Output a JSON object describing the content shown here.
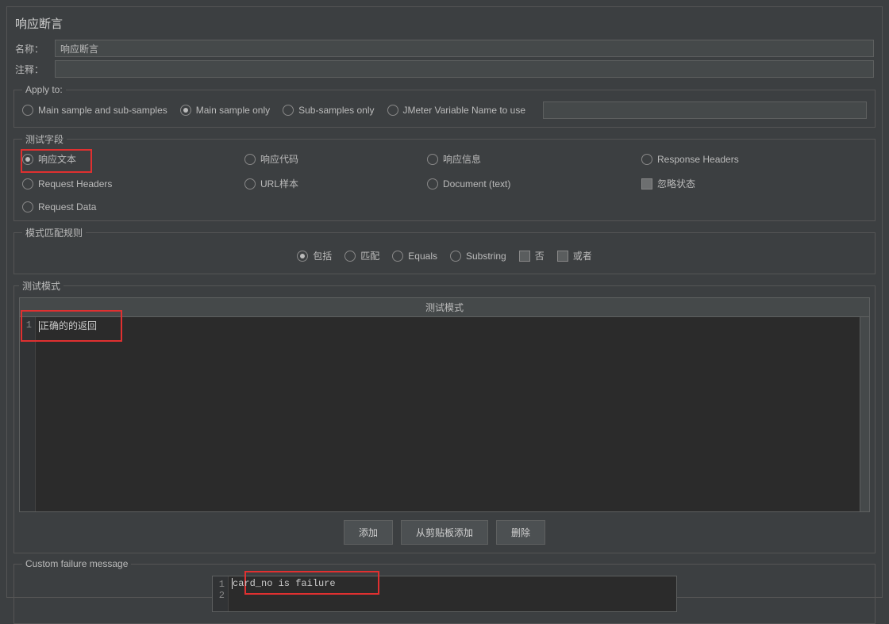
{
  "panel": {
    "title": "响应断言",
    "name_label": "名称：",
    "name_value": "响应断言",
    "comment_label": "注释：",
    "comment_value": ""
  },
  "apply_to": {
    "legend": "Apply to:",
    "options": {
      "main_sub": "Main sample and sub-samples",
      "main_only": "Main sample only",
      "sub_only": "Sub-samples only",
      "jmeter_var": "JMeter Variable Name to use"
    },
    "selected": "main_only",
    "var_value": ""
  },
  "test_fields": {
    "legend": "测试字段",
    "items": {
      "response_text": "响应文本",
      "response_code": "响应代码",
      "response_msg": "响应信息",
      "response_headers": "Response Headers",
      "request_headers": "Request Headers",
      "url_sample": "URL样本",
      "document_text": "Document (text)",
      "ignore_status": "忽略状态",
      "request_data": "Request Data"
    },
    "selected": "response_text"
  },
  "pattern_rules": {
    "legend": "模式匹配规则",
    "items": {
      "contains": "包括",
      "match": "匹配",
      "equals": "Equals",
      "substring": "Substring",
      "not": "否",
      "or": "或者"
    },
    "selected": "contains"
  },
  "test_pattern": {
    "legend": "测试模式",
    "header": "测试模式",
    "lines": [
      "正确的的返回"
    ],
    "buttons": {
      "add": "添加",
      "add_clip": "从剪贴板添加",
      "delete": "删除"
    }
  },
  "custom_failure": {
    "legend": "Custom failure message",
    "lines": [
      "card_no is failure",
      ""
    ]
  }
}
